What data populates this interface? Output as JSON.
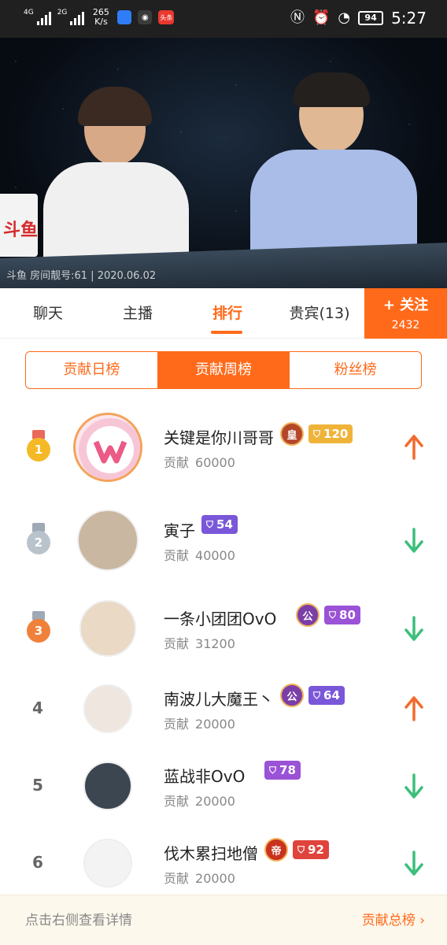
{
  "status_bar": {
    "signal1": "4G",
    "signal2": "2G",
    "speed_value": "265",
    "speed_unit": "K/s",
    "app_icon_toutiao": "头条",
    "battery": "94",
    "time": "5:27",
    "icons": [
      "nfc-icon",
      "alarm-icon",
      "speed-icon"
    ]
  },
  "video": {
    "watermark": "斗鱼 房间靓号:61 | 2020.06.02",
    "logo_text": "斗鱼"
  },
  "tabs": {
    "items": [
      {
        "label": "聊天"
      },
      {
        "label": "主播"
      },
      {
        "label": "排行"
      },
      {
        "label": "贵宾",
        "count": "(13)"
      }
    ],
    "active_index": 2,
    "follow_label": "+ 关注",
    "follow_count": "2432"
  },
  "ranking_tabs": {
    "items": [
      "贡献日榜",
      "贡献周榜",
      "粉丝榜"
    ],
    "active_index": 1
  },
  "ranking": {
    "contrib_label": "贡献",
    "rows": [
      {
        "rank": "1",
        "name": "关键是你川哥哥",
        "contribution": "60000",
        "noble": "皇",
        "level": "120",
        "level_color": "#f0b33a",
        "trend": "up"
      },
      {
        "rank": "2",
        "name": "寅子",
        "contribution": "40000",
        "noble": "",
        "level": "54",
        "level_color": "#7a57d9",
        "trend": "down"
      },
      {
        "rank": "3",
        "name": "一条小团团OvO",
        "contribution": "31200",
        "noble": "公",
        "level": "80",
        "level_color": "#9a52d6",
        "trend": "down"
      },
      {
        "rank": "4",
        "name": "南波儿大魔王丶",
        "contribution": "20000",
        "noble": "公",
        "level": "64",
        "level_color": "#7a57d9",
        "trend": "up"
      },
      {
        "rank": "5",
        "name": "蓝战非OvO",
        "contribution": "20000",
        "noble": "",
        "level": "78",
        "level_color": "#9a52d6",
        "trend": "down"
      },
      {
        "rank": "6",
        "name": "伐木累扫地僧",
        "contribution": "20000",
        "noble": "帝",
        "level": "92",
        "level_color": "#e0433b",
        "trend": "down"
      }
    ]
  },
  "colors": {
    "accent": "#ff6a1a",
    "up": "#f26a2e",
    "down": "#3bbf7a",
    "gold": "#f5b925",
    "silver": "#b9c3cc",
    "bronze": "#f0813a"
  },
  "footer": {
    "hint": "点击右侧查看详情",
    "total_label": "贡献总榜 ›"
  }
}
